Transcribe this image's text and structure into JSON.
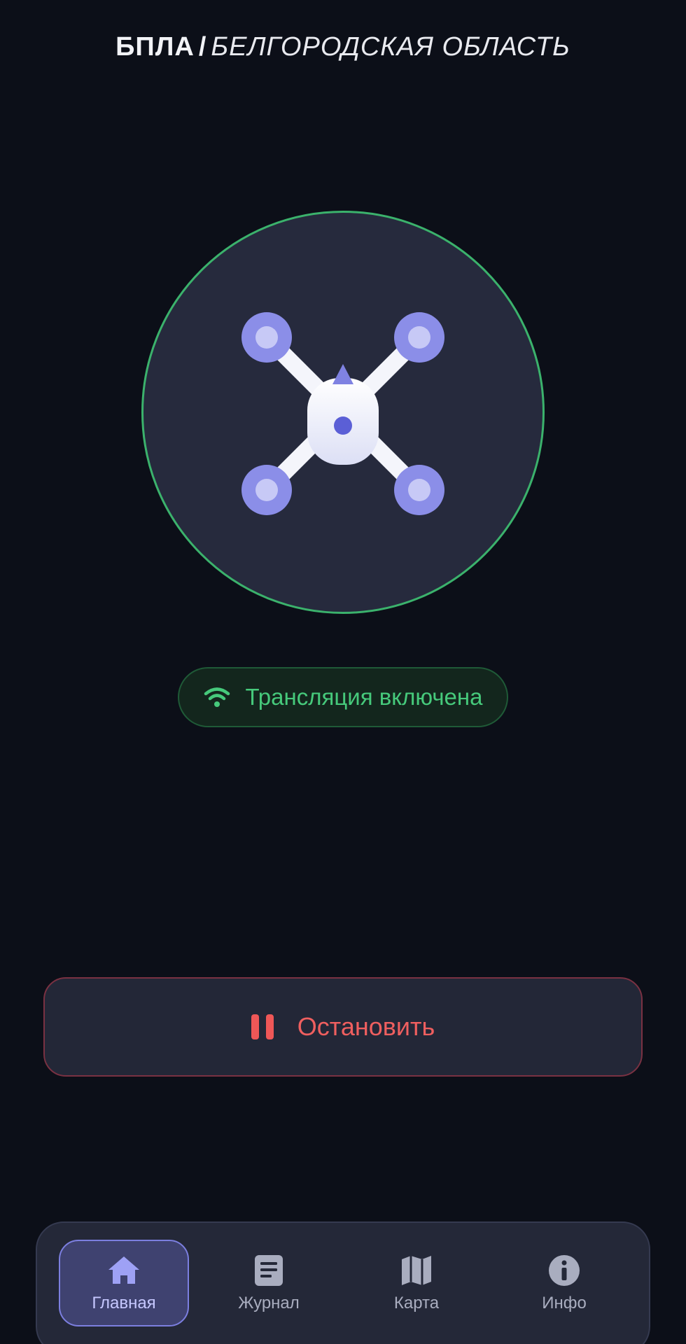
{
  "header": {
    "prefix": "БПЛА",
    "separator": "/",
    "region": "БЕЛГОРОДСКАЯ ОБЛАСТЬ"
  },
  "drone": {
    "icon": "quadcopter-drone-icon",
    "ring_color": "#3bb26c",
    "rotor_color": "#8b8ee8",
    "body_color": "#f2f3fb"
  },
  "status": {
    "icon": "wifi-icon",
    "label": "Трансляция включена",
    "color": "#46c97b"
  },
  "stop_button": {
    "icon": "pause-icon",
    "label": "Остановить",
    "color": "#ef5757"
  },
  "nav": {
    "items": [
      {
        "icon": "home-icon",
        "label": "Главная",
        "active": true
      },
      {
        "icon": "journal-icon",
        "label": "Журнал",
        "active": false
      },
      {
        "icon": "map-icon",
        "label": "Карта",
        "active": false
      },
      {
        "icon": "info-icon",
        "label": "Инфо",
        "active": false
      }
    ],
    "active_color": "#7c7fe0"
  }
}
